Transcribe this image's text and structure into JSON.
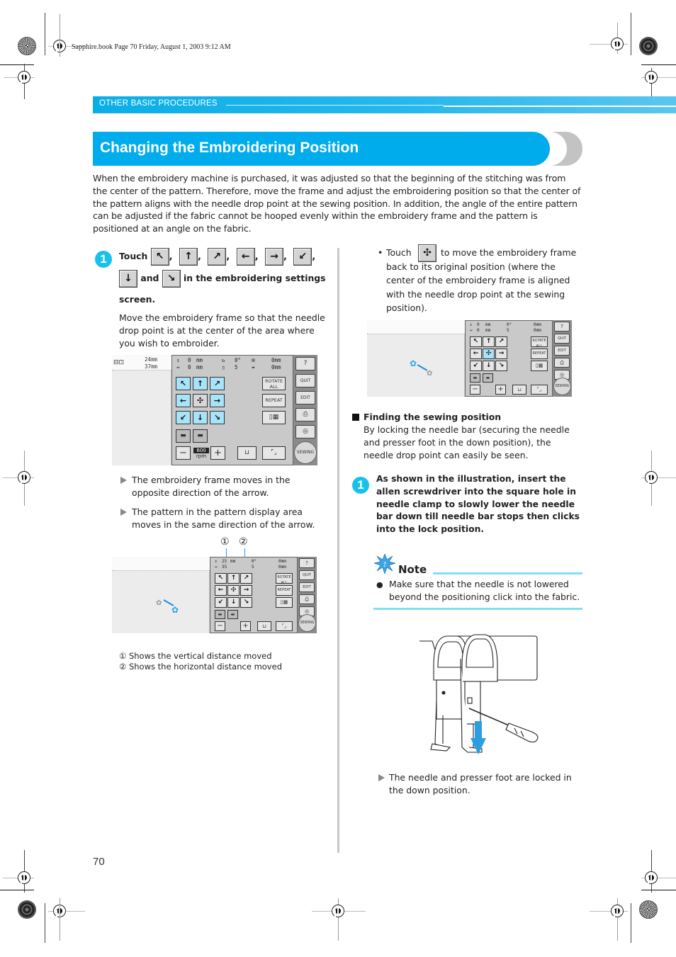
{
  "slug": "Sapphire.book  Page 70  Friday, August 1, 2003  9:12 AM",
  "section_header": "OTHER BASIC PROCEDURES",
  "title": "Changing the Embroidering Position",
  "intro": "When the embroidery machine is purchased, it was adjusted so that the beginning of the stitching was from the center of the pattern. Therefore, move the frame and adjust the embroidering position so that the center of the pattern aligns with the needle drop point at the sewing position. In addition, the angle of the entire pattern can be adjusted if the fabric cannot be hooped evenly within the embroidery frame and the pattern is positioned at an angle on the fabric.",
  "colors": {
    "accent": "#00acec",
    "step_badge": "#17c1ea",
    "note_rule": "#7fe0f2",
    "key_highlight": "#a8e4f7"
  },
  "step1": {
    "number": "1",
    "touch_label": "Touch",
    "icons": [
      {
        "name": "arrow-up-left-icon",
        "glyph": "↖"
      },
      {
        "name": "arrow-up-icon",
        "glyph": "↑"
      },
      {
        "name": "arrow-up-right-icon",
        "glyph": "↗"
      },
      {
        "name": "arrow-left-icon",
        "glyph": "←"
      },
      {
        "name": "arrow-right-icon",
        "glyph": "→"
      },
      {
        "name": "arrow-down-left-icon",
        "glyph": "↙"
      },
      {
        "name": "arrow-down-icon",
        "glyph": "↓"
      },
      {
        "name": "arrow-down-right-icon",
        "glyph": "↘"
      }
    ],
    "comma": ",",
    "and_label": "and",
    "tail_label": "in the embroidering settings",
    "screen_label": "screen.",
    "description": "Move the embroidery frame so that the needle drop point is at the center of the area where you wish to embroider."
  },
  "screen1": {
    "size_h": "24mm",
    "size_w": "37mm",
    "readout": {
      "v": "0",
      "h": "0",
      "unit": "mm",
      "angle": "0°",
      "color_count": "5",
      "off1": "0mm",
      "off2": "0mm"
    },
    "buttons": {
      "rotate_all": "ROTATE ALL",
      "repeat": "REPEAT",
      "quit": "QUIT",
      "edit": "EDIT",
      "sewing": "SEWING",
      "speed": "600",
      "speed_unit": "rpm",
      "minus": "−",
      "plus": "+"
    }
  },
  "results": [
    "The embroidery frame moves in the opposite direction of the arrow.",
    "The pattern in the pattern display area moves in the same direction of the arrow."
  ],
  "screen2": {
    "callouts": [
      "①",
      "②"
    ],
    "readout": {
      "v": "25",
      "h": "35",
      "unit": "mm",
      "angle": "0°",
      "color_count": "5",
      "off1": "0mm",
      "off2": "0mm"
    }
  },
  "legend": [
    {
      "mark": "①",
      "text": "Shows the vertical distance moved"
    },
    {
      "mark": "②",
      "text": "Shows the horizontal distance moved"
    }
  ],
  "bullet_touch": {
    "bullet": "•",
    "touch_label": "Touch",
    "icon": "center-position-icon",
    "text_first": "to move the embroidery frame",
    "text_rest": "back to its original position (where the center of the embroidery frame is aligned with the needle drop point at the sewing position)."
  },
  "screen3": {
    "readout": {
      "v": "0",
      "h": "0",
      "unit": "mm",
      "angle": "0°",
      "color_count": "5",
      "off1": "0mm",
      "off2": "0mm"
    }
  },
  "finding": {
    "heading": "Finding the sewing position",
    "text": "By locking the needle bar (securing the needle and presser foot in the down position), the needle drop point can easily be seen."
  },
  "step_finding": {
    "number": "1",
    "text": "As shown in the illustration, insert the allen screwdriver into the square hole in needle clamp to slowly lower the needle bar down till needle bar stops then clicks into the lock position."
  },
  "note": {
    "title": "Note",
    "bullet": "●",
    "text": "Make sure that the needle is not lowered beyond the positioning click into the fabric."
  },
  "illustration_result": "The needle and presser foot are locked in the down position.",
  "page_number": "70"
}
